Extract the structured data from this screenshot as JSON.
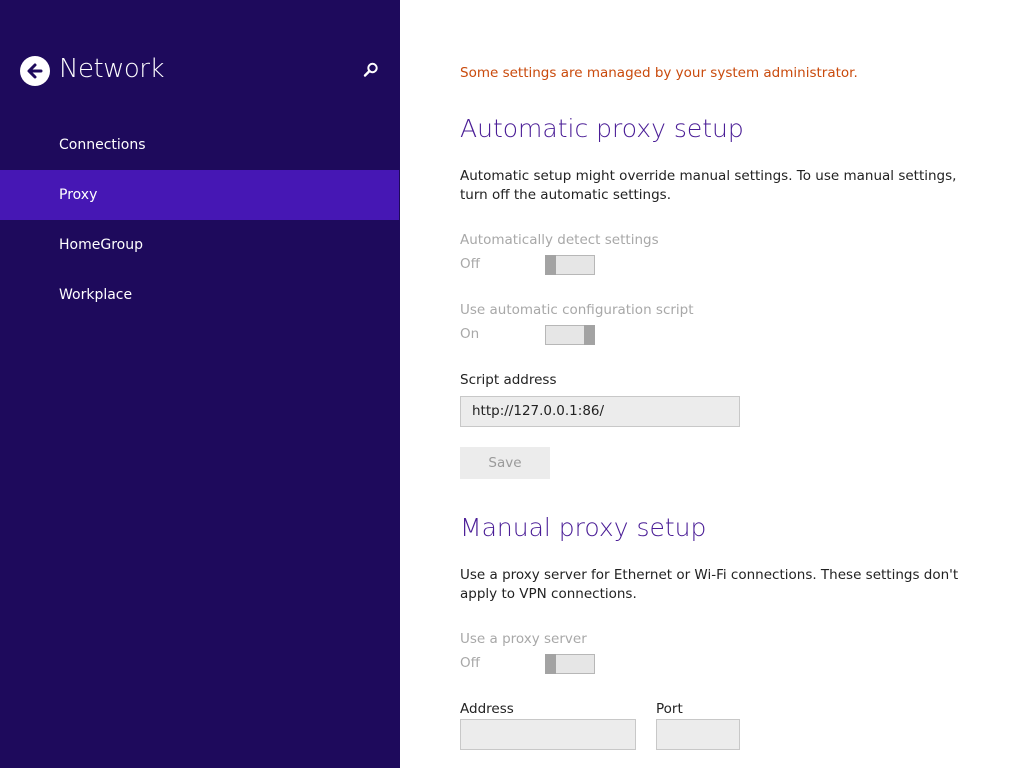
{
  "sidebar": {
    "title": "Network",
    "back_icon": "arrow-left-icon",
    "search_icon": "search-icon",
    "items": [
      {
        "label": "Connections"
      },
      {
        "label": "Proxy"
      },
      {
        "label": "HomeGroup"
      },
      {
        "label": "Workplace"
      }
    ],
    "selected_index": 1,
    "colors": {
      "background": "#1e0a5c",
      "selected": "#4617b4"
    }
  },
  "main": {
    "admin_notice": "Some settings are managed by your system administrator.",
    "automatic": {
      "heading": "Automatic proxy setup",
      "description": "Automatic setup might override manual settings. To use manual settings, turn off the automatic settings.",
      "detect": {
        "label": "Automatically detect settings",
        "state": "Off",
        "on": false
      },
      "script": {
        "label": "Use automatic configuration script",
        "state": "On",
        "on": true
      },
      "script_address": {
        "label": "Script address",
        "value": "http://127.0.0.1:86/"
      },
      "save_label": "Save"
    },
    "manual": {
      "heading": "Manual proxy setup",
      "description": "Use a proxy server for Ethernet or Wi-Fi connections. These settings don't apply to VPN connections.",
      "use_proxy": {
        "label": "Use a proxy server",
        "state": "Off",
        "on": false
      },
      "address": {
        "label": "Address",
        "value": ""
      },
      "port": {
        "label": "Port",
        "value": ""
      }
    },
    "colors": {
      "heading": "#4a1d96",
      "notice": "#c94a0c"
    }
  }
}
